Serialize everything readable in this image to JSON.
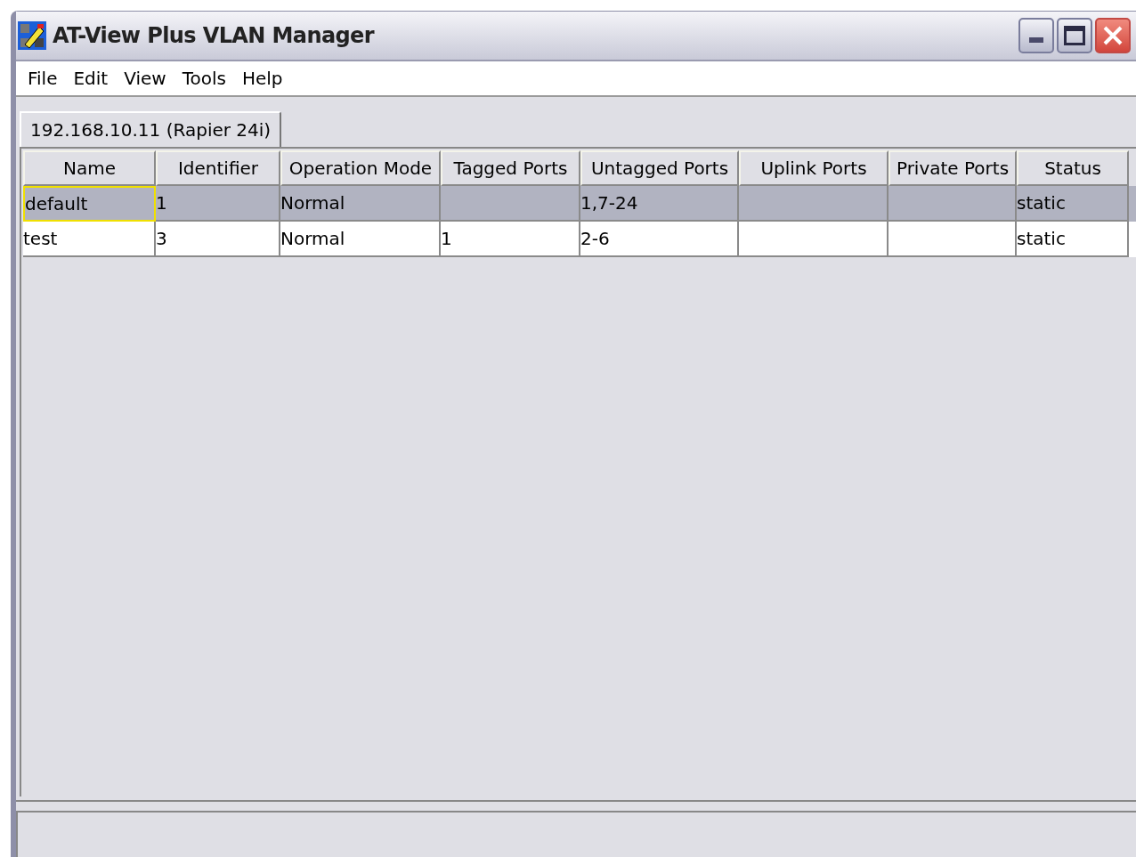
{
  "window": {
    "title": "AT-View Plus VLAN Manager"
  },
  "menu": [
    "File",
    "Edit",
    "View",
    "Tools",
    "Help"
  ],
  "tabs": [
    {
      "label": "192.168.10.11 (Rapier 24i)",
      "selected": true
    }
  ],
  "table": {
    "columns": [
      "Name",
      "Identifier",
      "Operation Mode",
      "Tagged Ports",
      "Untagged Ports",
      "Uplink Ports",
      "Private Ports",
      "Status"
    ],
    "rows": [
      {
        "selected": true,
        "cells": [
          {
            "text": "default",
            "focused": true
          },
          {
            "text": "1",
            "focused": false
          },
          {
            "text": "Normal",
            "focused": false
          },
          {
            "focused": false
          },
          {
            "text": "1,7-24",
            "focused": false
          },
          {
            "focused": false
          },
          {
            "focused": false
          },
          {
            "text": "static",
            "focused": false
          }
        ]
      },
      {
        "selected": false,
        "cells": [
          {
            "text": "test",
            "focused": false
          },
          {
            "text": "3",
            "focused": false
          },
          {
            "text": "Normal",
            "focused": false
          },
          {
            "text": "1",
            "focused": false
          },
          {
            "text": "2-6",
            "focused": false
          },
          {
            "focused": false
          },
          {
            "focused": false
          },
          {
            "text": "static",
            "focused": false
          }
        ]
      }
    ]
  }
}
